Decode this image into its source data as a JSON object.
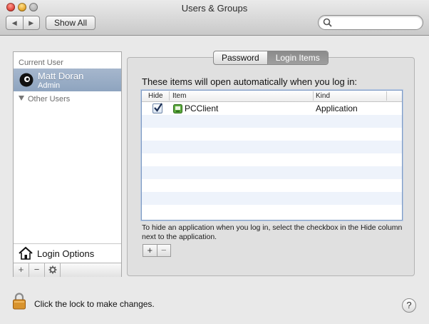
{
  "window": {
    "title": "Users & Groups",
    "show_all_label": "Show All",
    "search_placeholder": "",
    "nav_back_icon": "back-arrow-icon",
    "nav_forward_icon": "forward-arrow-icon"
  },
  "sidebar": {
    "current_user_header": "Current User",
    "current_user": {
      "name": "Matt Doran",
      "role": "Admin",
      "icon": "avatar-icon"
    },
    "other_users_label": "Other Users",
    "login_options_label": "Login Options",
    "bottom_buttons": [
      "+",
      "−",
      "gear-icon"
    ]
  },
  "tabs": {
    "items": [
      "Password",
      "Login Items"
    ],
    "active": "Login Items"
  },
  "main": {
    "intro_text": "These items will open automatically when you log in:",
    "table": {
      "columns": [
        "Hide",
        "Item",
        "Kind"
      ],
      "rows": [
        {
          "hide": true,
          "item": "PCClient",
          "kind": "Application",
          "icon": "application-icon"
        }
      ]
    },
    "hint_text": "To hide an application when you log in, select the checkbox in the Hide column next to the application.",
    "add_label": "+",
    "remove_label": "−"
  },
  "footer": {
    "lock_text": "Click the lock to make changes.",
    "help_label": "?"
  },
  "colors": {
    "selection": "#8ea4bf",
    "table_focus": "#7f9bc4",
    "alt_row": "#eef3fb"
  }
}
